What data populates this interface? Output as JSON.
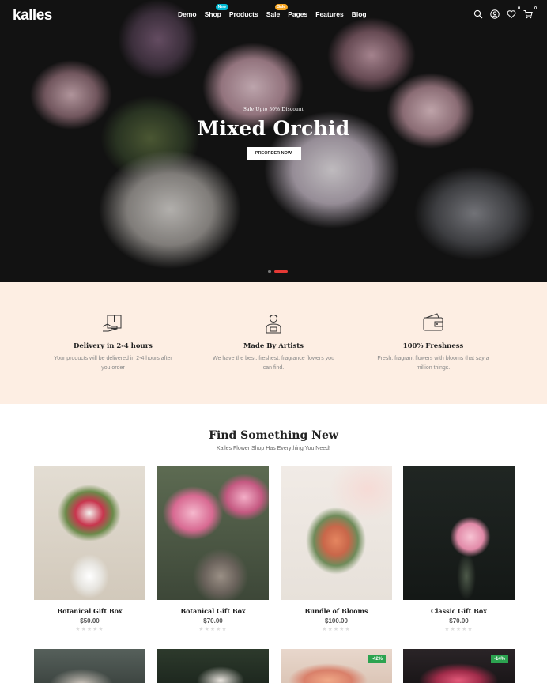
{
  "brand": {
    "logo": "kalles"
  },
  "nav": {
    "items": [
      {
        "label": "Demo"
      },
      {
        "label": "Shop",
        "badge": "New"
      },
      {
        "label": "Products"
      },
      {
        "label": "Sale",
        "badge": "Sale"
      },
      {
        "label": "Pages"
      },
      {
        "label": "Features"
      },
      {
        "label": "Blog"
      }
    ],
    "icons": [
      "search-icon",
      "user-icon",
      "heart-icon",
      "cart-icon"
    ],
    "wishlist_count": "0",
    "cart_count": "0"
  },
  "hero": {
    "kicker": "Sale Upto 50% Discount",
    "title": "Mixed Orchid",
    "button": "PREORDER NOW",
    "slides": 2,
    "active_slide": 2
  },
  "features": [
    {
      "icon": "delivery-box-icon",
      "title": "Delivery in 2-4 hours",
      "desc": "Your products will be delivered in 2-4 hours after you order"
    },
    {
      "icon": "artist-icon",
      "title": "Made By Artists",
      "desc": "We have the best, freshest, fragrance flowers you can find."
    },
    {
      "icon": "wallet-icon",
      "title": "100% Freshness",
      "desc": "Fresh, fragrant flowers with blooms that say a million things."
    }
  ],
  "section": {
    "title": "Find Something New",
    "subtitle": "Kalles Flower Shop Has Everything You Need!"
  },
  "products": [
    {
      "name": "Botanical Gift Box",
      "price": "$50.00",
      "rating": 0
    },
    {
      "name": "Botanical Gift Box",
      "price": "$70.00",
      "rating": 0
    },
    {
      "name": "Bundle of Blooms",
      "price": "$100.00",
      "rating": 0
    },
    {
      "name": "Classic Gift Box",
      "price": "$70.00",
      "rating": 0
    }
  ],
  "products_row2": [
    {
      "discount": ""
    },
    {
      "discount": ""
    },
    {
      "discount": "-42%"
    },
    {
      "discount": "-14%"
    }
  ],
  "colors": {
    "accent": "#e53935",
    "new_badge": "#01bad4",
    "sale_badge": "#f6a623",
    "features_bg": "#fdeee3",
    "discount_badge": "#2ca350"
  }
}
